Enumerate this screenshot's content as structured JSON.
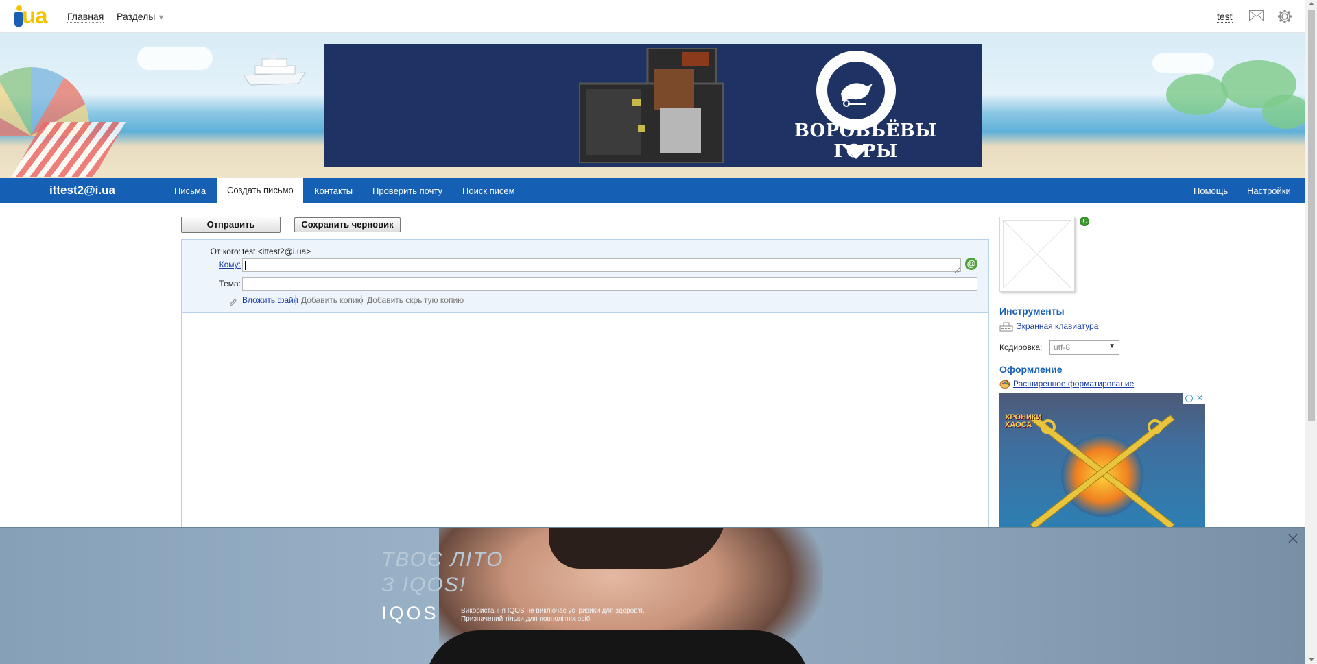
{
  "topbar": {
    "logo_text": "ua",
    "home_label": "Главная",
    "sections_label": "Разделы",
    "sections_arrow": "▼",
    "user_label": "test",
    "icons": [
      "mail-icon",
      "gear-icon"
    ]
  },
  "banner_ad": {
    "title": "ВОРОБЬЁВЫ ГОРЫ"
  },
  "mainnav": {
    "account_email": "ittest2@i.ua",
    "tabs": [
      {
        "label": "Письма",
        "active": false
      },
      {
        "label": "Создать письмо",
        "active": true
      },
      {
        "label": "Контакты",
        "active": false
      },
      {
        "label": "Проверить почту",
        "active": false
      },
      {
        "label": "Поиск писем",
        "active": false
      }
    ],
    "help_label": "Помощь",
    "settings_label": "Настройки"
  },
  "compose": {
    "send_label": "Отправить",
    "draft_label": "Сохранить черновик",
    "from_label": "От кого:",
    "from_value": "test <ittest2@i.ua>",
    "to_label": "Кому:",
    "to_value": "",
    "subject_label": "Тема:",
    "subject_value": "",
    "attach_label": "Вложить файл",
    "add_cc_label": "Добавить копию",
    "add_bcc_label": "Добавить скрытую копию",
    "at_symbol": "@",
    "body": ""
  },
  "sidebar": {
    "tools_title": "Инструменты",
    "keyboard_label": "Экранная клавиатура",
    "encoding_label": "Кодировка:",
    "encoding_value": "utf-8",
    "design_title": "Оформление",
    "format_label": "Расширенное форматирование",
    "side_ad_label": "ХРОНИКИ ХАОСА"
  },
  "bottom_ad": {
    "line1": "ТВОЄ ЛІТО",
    "line2": "З IQOS!",
    "brand": "IQOS",
    "disclaimer": "Використання IQOS не виключає усі ризики для здоров'я. Призначений тільки для повнолітніх осіб."
  },
  "colors": {
    "nav_blue": "#1560b5",
    "link_blue": "#1a3faa",
    "banner_ad_bg": "#1e3263",
    "logo_yellow": "#f5c400"
  }
}
